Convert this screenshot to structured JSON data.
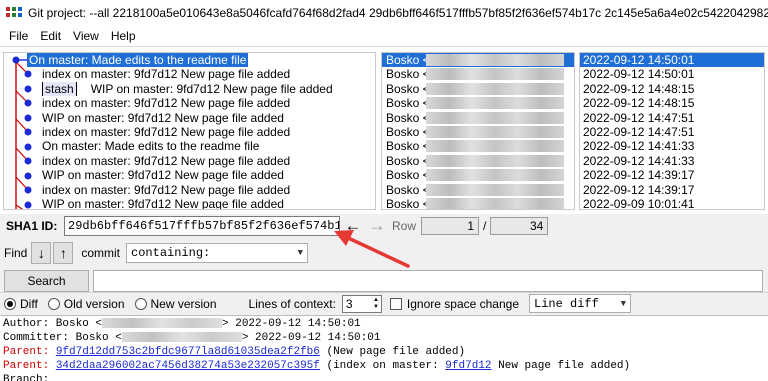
{
  "window": {
    "title": "Git project: --all 2218100a5e010643e8a5046fcafd764f68d2fad4 29db6bff646f517fffb57bf85f2f636ef574b17c 2c145e5a6a4e02c5422042982468cbdcbebc"
  },
  "menu": [
    "File",
    "Edit",
    "View",
    "Help"
  ],
  "commits": [
    {
      "message": "On master: Made edits to the readme file",
      "author": "Bosko <",
      "date": "2022-09-12 14:50:01",
      "selected": true
    },
    {
      "message": "index on master: 9fd7d12 New page file added",
      "author": "Bosko <",
      "date": "2022-09-12 14:50:01"
    },
    {
      "tag": "stash",
      "message": "WIP on master: 9fd7d12 New page file added",
      "author": "Bosko <",
      "date": "2022-09-12 14:48:15"
    },
    {
      "message": "index on master: 9fd7d12 New page file added",
      "author": "Bosko <",
      "date": "2022-09-12 14:48:15"
    },
    {
      "message": "WIP on master: 9fd7d12 New page file added",
      "author": "Bosko <",
      "date": "2022-09-12 14:47:51"
    },
    {
      "message": "index on master: 9fd7d12 New page file added",
      "author": "Bosko <",
      "date": "2022-09-12 14:47:51"
    },
    {
      "message": "On master: Made edits to the readme file",
      "author": "Bosko <",
      "date": "2022-09-12 14:41:33"
    },
    {
      "message": "index on master: 9fd7d12 New page file added",
      "author": "Bosko <",
      "date": "2022-09-12 14:41:33"
    },
    {
      "message": "WIP on master: 9fd7d12 New page file added",
      "author": "Bosko <",
      "date": "2022-09-12 14:39:17"
    },
    {
      "message": "index on master: 9fd7d12 New page file added",
      "author": "Bosko <",
      "date": "2022-09-12 14:39:17"
    },
    {
      "message": "WIP on master: 9fd7d12 New page file added",
      "author": "Bosko <",
      "date": "2022-09-09 10:01:41"
    }
  ],
  "sha": {
    "label": "SHA1 ID:",
    "value": "29db6bff646f517fffb57bf85f2f636ef574b17c",
    "back_icon": "left-arrow-icon",
    "forward_icon": "right-arrow-icon"
  },
  "row_nav": {
    "label": "Row",
    "current": "1",
    "separator": "/",
    "total": "34"
  },
  "find": {
    "label": "Find",
    "down_icon": "down-arrow-icon",
    "up_icon": "up-arrow-icon",
    "type": "commit",
    "mode": "containing:"
  },
  "search": {
    "button": "Search",
    "value": ""
  },
  "options": {
    "diff": "Diff",
    "old_version": "Old version",
    "new_version": "New version",
    "context_label": "Lines of context:",
    "context_value": "3",
    "ignore_space": "Ignore space change",
    "diff_mode": "Line diff"
  },
  "details": {
    "author_prefix": "Author: Bosko <",
    "author_suffix": ">  2022-09-12 14:50:01",
    "committer_prefix": "Committer: Bosko <",
    "committer_suffix": ">  2022-09-12 14:50:01",
    "parent_label": "Parent:",
    "parent1_sha": "9fd7d12dd753c2bfdc9677la8d61035dea2f2fb6",
    "parent1_desc": " (New page file added)",
    "parent2_sha": "34d2daa296002ac7456d38274a53e232057c395f",
    "parent2_desc_a": " (index on master: ",
    "parent2_link": "9fd7d12",
    "parent2_desc_b": " New page file added)",
    "branch_partial": "Branch:"
  },
  "colors": {
    "selection": "#1f6fd6",
    "graph_line": "#d00000",
    "node": "#1a2bd6",
    "annotation": "#e53935"
  }
}
